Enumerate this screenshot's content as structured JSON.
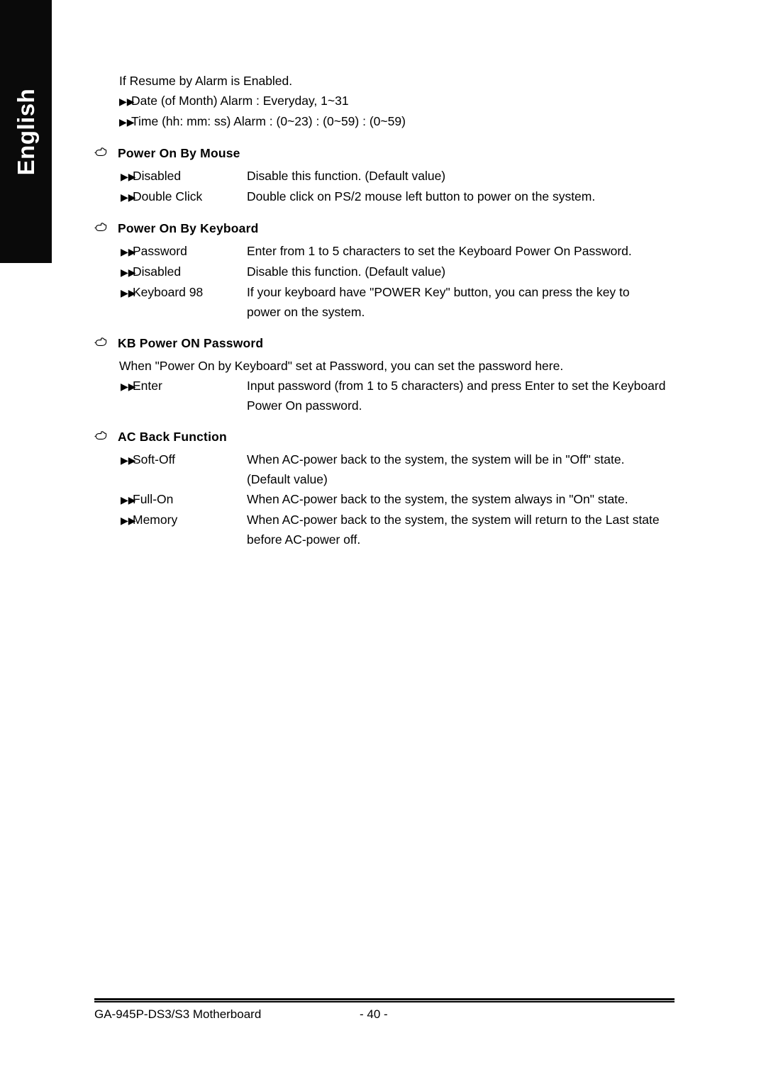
{
  "sidebar": {
    "language_label": "English"
  },
  "intro": {
    "lead": "If Resume by Alarm is Enabled.",
    "items": [
      "Date (of Month) Alarm :  Everyday, 1~31",
      "Time (hh: mm: ss) Alarm :   (0~23) : (0~59) : (0~59)"
    ]
  },
  "icons": {
    "section_marker": "pointing-hand-icon",
    "option_marker": "double-triangle-icon",
    "option_marker_glyph": "▶▶"
  },
  "sections": [
    {
      "title": "Power On By Mouse",
      "note": "",
      "options": [
        {
          "label": "Disabled",
          "desc": "Disable this function. (Default value)",
          "desc2": ""
        },
        {
          "label": "Double Click",
          "desc": "Double click on PS/2 mouse left button to power on the system.",
          "desc2": ""
        }
      ]
    },
    {
      "title": "Power On By Keyboard",
      "note": "",
      "options": [
        {
          "label": "Password",
          "desc": "Enter from 1 to 5 characters to set the Keyboard Power On Password.",
          "desc2": ""
        },
        {
          "label": "Disabled",
          "desc": "Disable this function. (Default value)",
          "desc2": ""
        },
        {
          "label": "Keyboard 98",
          "desc": "If your keyboard have \"POWER Key\" button, you can press the key to",
          "desc2": "power on the system."
        }
      ]
    },
    {
      "title": "KB Power ON Password",
      "note": "When \"Power On by Keyboard\" set at Password, you can set the password here.",
      "options": [
        {
          "label": "Enter",
          "desc": "Input password (from 1 to 5 characters) and press Enter to set the Keyboard",
          "desc2": "Power On password."
        }
      ]
    },
    {
      "title": "AC Back Function",
      "note": "",
      "options": [
        {
          "label": "Soft-Off",
          "desc": "When AC-power back to the system, the system will be in \"Off\" state.",
          "desc2": "(Default value)"
        },
        {
          "label": "Full-On",
          "desc": "When AC-power back to the system, the system always in \"On\" state.",
          "desc2": ""
        },
        {
          "label": "Memory",
          "desc": "When AC-power back to the system, the system will return to the Last state",
          "desc2": "before AC-power off."
        }
      ]
    }
  ],
  "footer": {
    "product": "GA-945P-DS3/S3 Motherboard",
    "page_number": "-  40  -"
  }
}
